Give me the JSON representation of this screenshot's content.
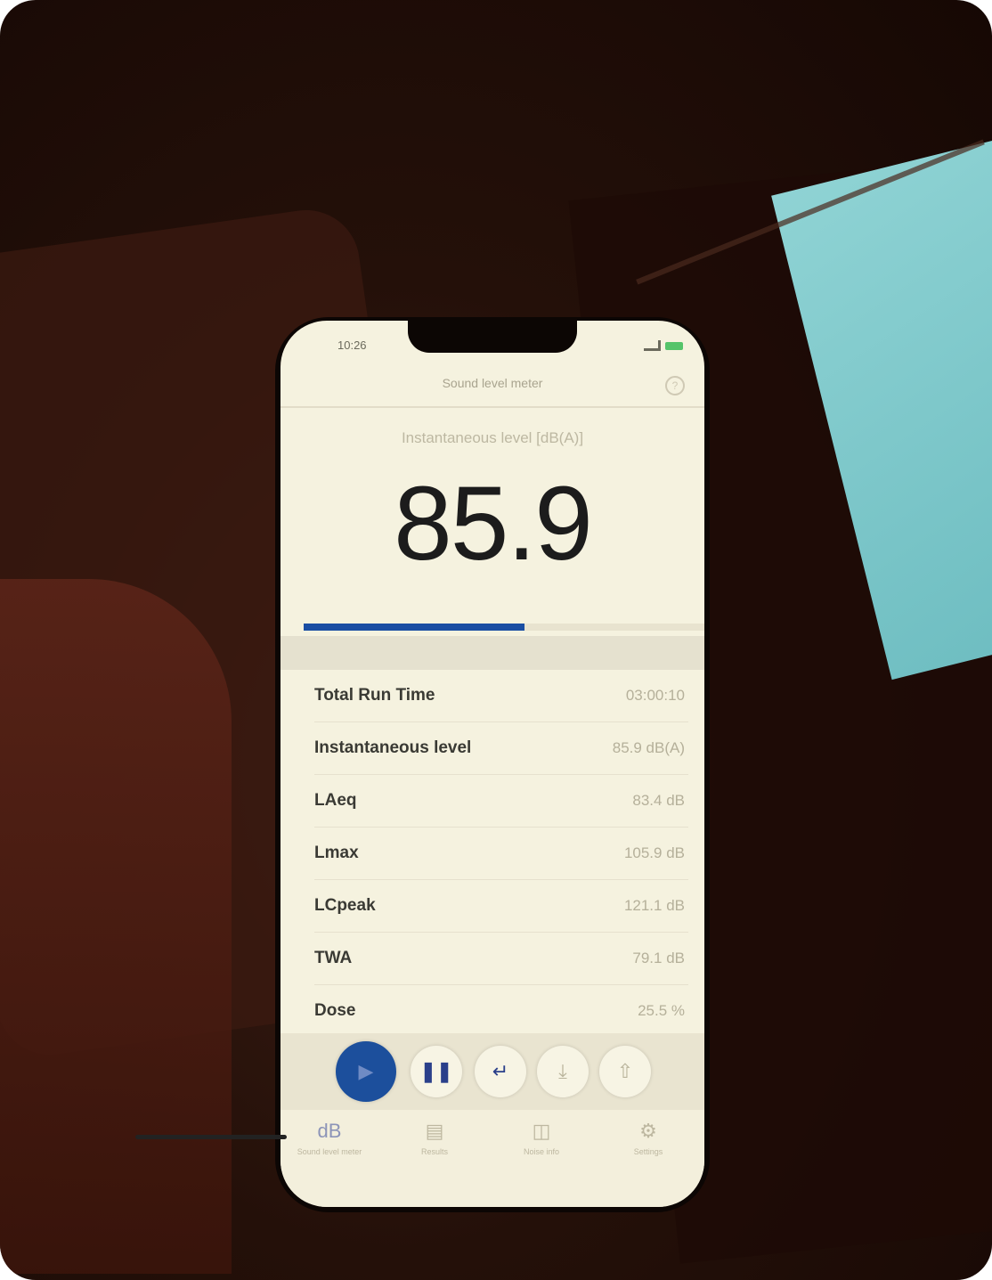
{
  "status": {
    "time": "10:26"
  },
  "header": {
    "title": "Sound level meter",
    "help_icon": "question-circle-icon"
  },
  "meter": {
    "label": "Instantaneous level [dB(A)]",
    "value": "85.9",
    "level_fraction": 0.55,
    "bar_color": "#1a4ea3"
  },
  "stats": [
    {
      "label": "Total Run Time",
      "value": "03:00:10"
    },
    {
      "label": "Instantaneous level",
      "value": "85.9 dB(A)"
    },
    {
      "label": "LAeq",
      "value": "83.4 dB"
    },
    {
      "label": "Lmax",
      "value": "105.9 dB"
    },
    {
      "label": "LCpeak",
      "value": "121.1 dB"
    },
    {
      "label": "TWA",
      "value": "79.1 dB"
    },
    {
      "label": "Dose",
      "value": "25.5 %"
    }
  ],
  "controls": {
    "play_icon": "play-icon",
    "pause_icon": "pause-icon",
    "reset_icon": "reset-icon",
    "save_icon": "download-icon",
    "share_icon": "share-icon"
  },
  "tabs": [
    {
      "icon_text": "dB",
      "label": "Sound level meter"
    },
    {
      "icon": "archive-icon",
      "label": "Results"
    },
    {
      "icon": "book-icon",
      "label": "Noise info"
    },
    {
      "icon": "gear-icon",
      "label": "Settings"
    }
  ]
}
